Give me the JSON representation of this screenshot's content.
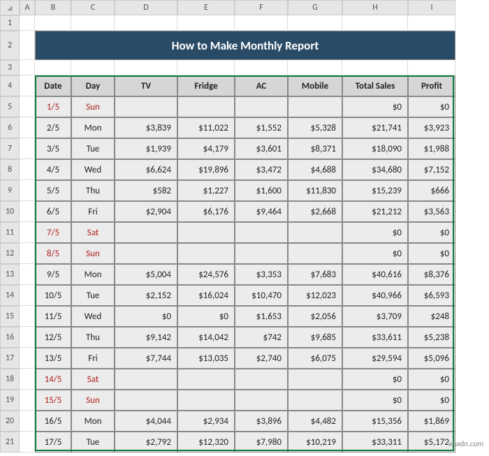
{
  "columns": [
    "A",
    "B",
    "C",
    "D",
    "E",
    "F",
    "G",
    "H",
    "I"
  ],
  "title": "How to Make Monthly Report",
  "headers": {
    "date": "Date",
    "day": "Day",
    "tv": "TV",
    "fridge": "Fridge",
    "ac": "AC",
    "mobile": "Mobile",
    "total": "Total Sales",
    "profit": "Profit"
  },
  "rows": [
    {
      "rn": 5,
      "date": "1/5",
      "day": "Sun",
      "tv": "",
      "fridge": "",
      "ac": "",
      "mobile": "",
      "total": "$0",
      "profit": "$0",
      "weekend": true
    },
    {
      "rn": 6,
      "date": "2/5",
      "day": "Mon",
      "tv": "$3,839",
      "fridge": "$11,022",
      "ac": "$1,552",
      "mobile": "$5,328",
      "total": "$21,741",
      "profit": "$3,923",
      "weekend": false
    },
    {
      "rn": 7,
      "date": "3/5",
      "day": "Tue",
      "tv": "$1,939",
      "fridge": "$4,179",
      "ac": "$3,601",
      "mobile": "$8,371",
      "total": "$18,090",
      "profit": "$1,988",
      "weekend": false
    },
    {
      "rn": 8,
      "date": "4/5",
      "day": "Wed",
      "tv": "$6,624",
      "fridge": "$19,896",
      "ac": "$3,472",
      "mobile": "$4,688",
      "total": "$34,680",
      "profit": "$7,152",
      "weekend": false
    },
    {
      "rn": 9,
      "date": "5/5",
      "day": "Thu",
      "tv": "$582",
      "fridge": "$1,227",
      "ac": "$1,600",
      "mobile": "$11,830",
      "total": "$15,239",
      "profit": "$666",
      "weekend": false
    },
    {
      "rn": 10,
      "date": "6/5",
      "day": "Fri",
      "tv": "$2,904",
      "fridge": "$6,176",
      "ac": "$9,464",
      "mobile": "$2,668",
      "total": "$21,212",
      "profit": "$3,563",
      "weekend": false
    },
    {
      "rn": 11,
      "date": "7/5",
      "day": "Sat",
      "tv": "",
      "fridge": "",
      "ac": "",
      "mobile": "",
      "total": "$0",
      "profit": "$0",
      "weekend": true
    },
    {
      "rn": 12,
      "date": "8/5",
      "day": "Sun",
      "tv": "",
      "fridge": "",
      "ac": "",
      "mobile": "",
      "total": "$0",
      "profit": "$0",
      "weekend": true
    },
    {
      "rn": 13,
      "date": "9/5",
      "day": "Mon",
      "tv": "$5,004",
      "fridge": "$24,576",
      "ac": "$3,353",
      "mobile": "$7,683",
      "total": "$40,616",
      "profit": "$8,376",
      "weekend": false
    },
    {
      "rn": 14,
      "date": "10/5",
      "day": "Tue",
      "tv": "$2,152",
      "fridge": "$16,024",
      "ac": "$10,470",
      "mobile": "$12,023",
      "total": "$40,966",
      "profit": "$6,593",
      "weekend": false
    },
    {
      "rn": 15,
      "date": "11/5",
      "day": "Wed",
      "tv": "$0",
      "fridge": "$0",
      "ac": "$1,653",
      "mobile": "$2,056",
      "total": "$3,709",
      "profit": "$248",
      "weekend": false
    },
    {
      "rn": 16,
      "date": "12/5",
      "day": "Thu",
      "tv": "$9,142",
      "fridge": "$14,042",
      "ac": "$742",
      "mobile": "$9,685",
      "total": "$33,611",
      "profit": "$5,238",
      "weekend": false
    },
    {
      "rn": 17,
      "date": "13/5",
      "day": "Fri",
      "tv": "$7,744",
      "fridge": "$13,035",
      "ac": "$2,740",
      "mobile": "$6,075",
      "total": "$29,594",
      "profit": "$5,096",
      "weekend": false
    },
    {
      "rn": 18,
      "date": "14/5",
      "day": "Sat",
      "tv": "",
      "fridge": "",
      "ac": "",
      "mobile": "",
      "total": "$0",
      "profit": "$0",
      "weekend": true
    },
    {
      "rn": 19,
      "date": "15/5",
      "day": "Sun",
      "tv": "",
      "fridge": "",
      "ac": "",
      "mobile": "",
      "total": "$0",
      "profit": "$0",
      "weekend": true
    },
    {
      "rn": 20,
      "date": "16/5",
      "day": "Mon",
      "tv": "$4,044",
      "fridge": "$2,934",
      "ac": "$3,896",
      "mobile": "$4,482",
      "total": "$15,356",
      "profit": "$1,869",
      "weekend": false
    },
    {
      "rn": 21,
      "date": "17/5",
      "day": "Tue",
      "tv": "$2,792",
      "fridge": "$12,320",
      "ac": "$7,980",
      "mobile": "$10,219",
      "total": "$33,311",
      "profit": "$5,172",
      "weekend": false
    }
  ],
  "watermark": "wsxdn.com"
}
